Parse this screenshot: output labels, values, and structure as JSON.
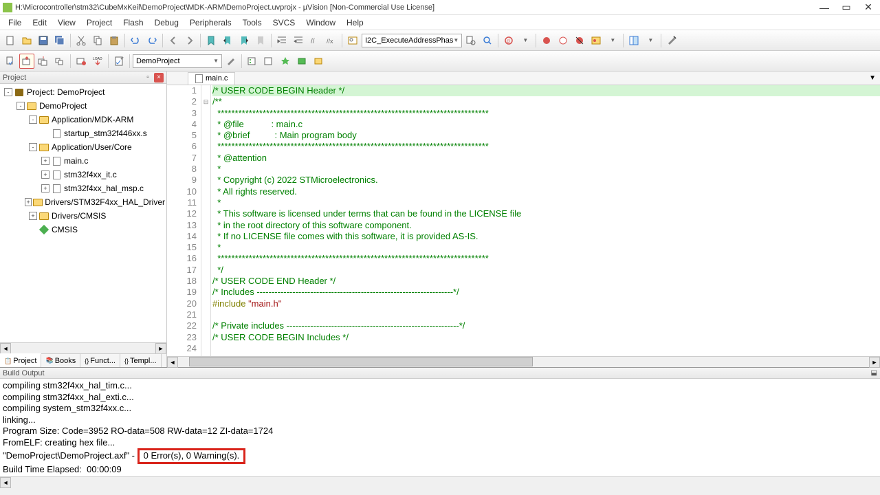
{
  "title": "H:\\Microcontroller\\stm32\\CubeMxKeil\\DemoProject\\MDK-ARM\\DemoProject.uvprojx - µVision  [Non-Commercial Use License]",
  "menu": [
    "File",
    "Edit",
    "View",
    "Project",
    "Flash",
    "Debug",
    "Peripherals",
    "Tools",
    "SVCS",
    "Window",
    "Help"
  ],
  "toolbar_combo1": "I2C_ExecuteAddressPhas",
  "toolbar2_combo": "DemoProject",
  "project_panel": {
    "title": "Project",
    "tree": [
      {
        "indent": 0,
        "exp": "-",
        "icon": "book",
        "label": "Project: DemoProject"
      },
      {
        "indent": 1,
        "exp": "-",
        "icon": "folder",
        "label": "DemoProject"
      },
      {
        "indent": 2,
        "exp": "-",
        "icon": "folder",
        "label": "Application/MDK-ARM"
      },
      {
        "indent": 3,
        "exp": "",
        "icon": "file",
        "label": "startup_stm32f446xx.s"
      },
      {
        "indent": 2,
        "exp": "-",
        "icon": "folder",
        "label": "Application/User/Core"
      },
      {
        "indent": 3,
        "exp": "+",
        "icon": "file",
        "label": "main.c"
      },
      {
        "indent": 3,
        "exp": "+",
        "icon": "file",
        "label": "stm32f4xx_it.c"
      },
      {
        "indent": 3,
        "exp": "+",
        "icon": "file",
        "label": "stm32f4xx_hal_msp.c"
      },
      {
        "indent": 2,
        "exp": "+",
        "icon": "folder",
        "label": "Drivers/STM32F4xx_HAL_Driver"
      },
      {
        "indent": 2,
        "exp": "+",
        "icon": "folder",
        "label": "Drivers/CMSIS"
      },
      {
        "indent": 2,
        "exp": "",
        "icon": "diamond",
        "label": "CMSIS"
      }
    ],
    "tabs": [
      "Project",
      "Books",
      "Funct...",
      "Templ..."
    ]
  },
  "editor": {
    "tab": "main.c",
    "lines": [
      {
        "n": 1,
        "hl": true,
        "cls": "c-comment",
        "text": "/* USER CODE BEGIN Header */"
      },
      {
        "n": 2,
        "fold": "-",
        "cls": "c-comment",
        "text": "/**"
      },
      {
        "n": 3,
        "cls": "c-comment",
        "text": "  ******************************************************************************"
      },
      {
        "n": 4,
        "cls": "c-comment",
        "text": "  * @file           : main.c"
      },
      {
        "n": 5,
        "cls": "c-comment",
        "text": "  * @brief          : Main program body"
      },
      {
        "n": 6,
        "cls": "c-comment",
        "text": "  ******************************************************************************"
      },
      {
        "n": 7,
        "cls": "c-comment",
        "text": "  * @attention"
      },
      {
        "n": 8,
        "cls": "c-comment",
        "text": "  *"
      },
      {
        "n": 9,
        "cls": "c-comment",
        "text": "  * Copyright (c) 2022 STMicroelectronics."
      },
      {
        "n": 10,
        "cls": "c-comment",
        "text": "  * All rights reserved."
      },
      {
        "n": 11,
        "cls": "c-comment",
        "text": "  *"
      },
      {
        "n": 12,
        "cls": "c-comment",
        "text": "  * This software is licensed under terms that can be found in the LICENSE file"
      },
      {
        "n": 13,
        "cls": "c-comment",
        "text": "  * in the root directory of this software component."
      },
      {
        "n": 14,
        "cls": "c-comment",
        "text": "  * If no LICENSE file comes with this software, it is provided AS-IS."
      },
      {
        "n": 15,
        "cls": "c-comment",
        "text": "  *"
      },
      {
        "n": 16,
        "cls": "c-comment",
        "text": "  ******************************************************************************"
      },
      {
        "n": 17,
        "cls": "c-comment",
        "text": "  */"
      },
      {
        "n": 18,
        "cls": "c-comment",
        "text": "/* USER CODE END Header */"
      },
      {
        "n": 19,
        "cls": "c-comment",
        "text": "/* Includes ------------------------------------------------------------------*/"
      },
      {
        "n": 20,
        "cls": "",
        "text": "#include \"main.h\""
      },
      {
        "n": 21,
        "cls": "",
        "text": ""
      },
      {
        "n": 22,
        "cls": "c-comment",
        "text": "/* Private includes ----------------------------------------------------------*/"
      },
      {
        "n": 23,
        "cls": "c-comment",
        "text": "/* USER CODE BEGIN Includes */"
      },
      {
        "n": 24,
        "cls": "",
        "text": ""
      }
    ]
  },
  "build": {
    "title": "Build Output",
    "lines": [
      "compiling stm32f4xx_hal_tim.c...",
      "compiling stm32f4xx_hal_exti.c...",
      "compiling system_stm32f4xx.c...",
      "linking...",
      "Program Size: Code=3952 RO-data=508 RW-data=12 ZI-data=1724",
      "FromELF: creating hex file..."
    ],
    "result_prefix": "\"DemoProject\\DemoProject.axf\" - ",
    "result_highlight": "0 Error(s), 0 Warning(s).",
    "elapsed": "Build Time Elapsed:  00:00:09"
  }
}
